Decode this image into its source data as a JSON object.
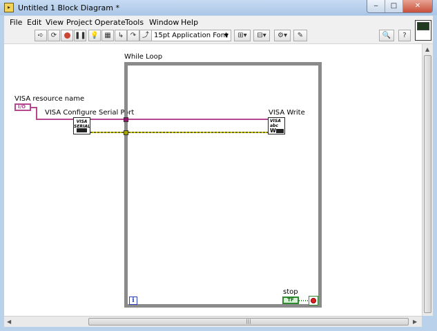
{
  "window": {
    "title": "Untitled 1 Block Diagram *",
    "controls": {
      "minimize": "‒",
      "maximize": "□",
      "close": "✕"
    }
  },
  "menu": {
    "items": [
      "File",
      "Edit",
      "View",
      "Project",
      "Operate",
      "Tools",
      "Window",
      "Help"
    ]
  },
  "toolbar": {
    "font_dropdown": "15pt Application Font"
  },
  "diagram": {
    "while_loop_label": "While Loop",
    "visa_resource_label": "VISA resource name",
    "visa_resource_const": "I/O",
    "configure_label": "VISA Configure Serial Port",
    "configure_icon_text": "VISA\nSERIAL",
    "write_label": "VISA Write",
    "write_icon_text": "VISA\nabc",
    "stop_label": "stop",
    "stop_terminal": "TF",
    "iteration_terminal": "i"
  },
  "colors": {
    "refnum_wire": "#b4478f",
    "error_wire": "#d8d000",
    "loop_border": "#8a8a8a",
    "boolean": "#2d8a2d"
  }
}
